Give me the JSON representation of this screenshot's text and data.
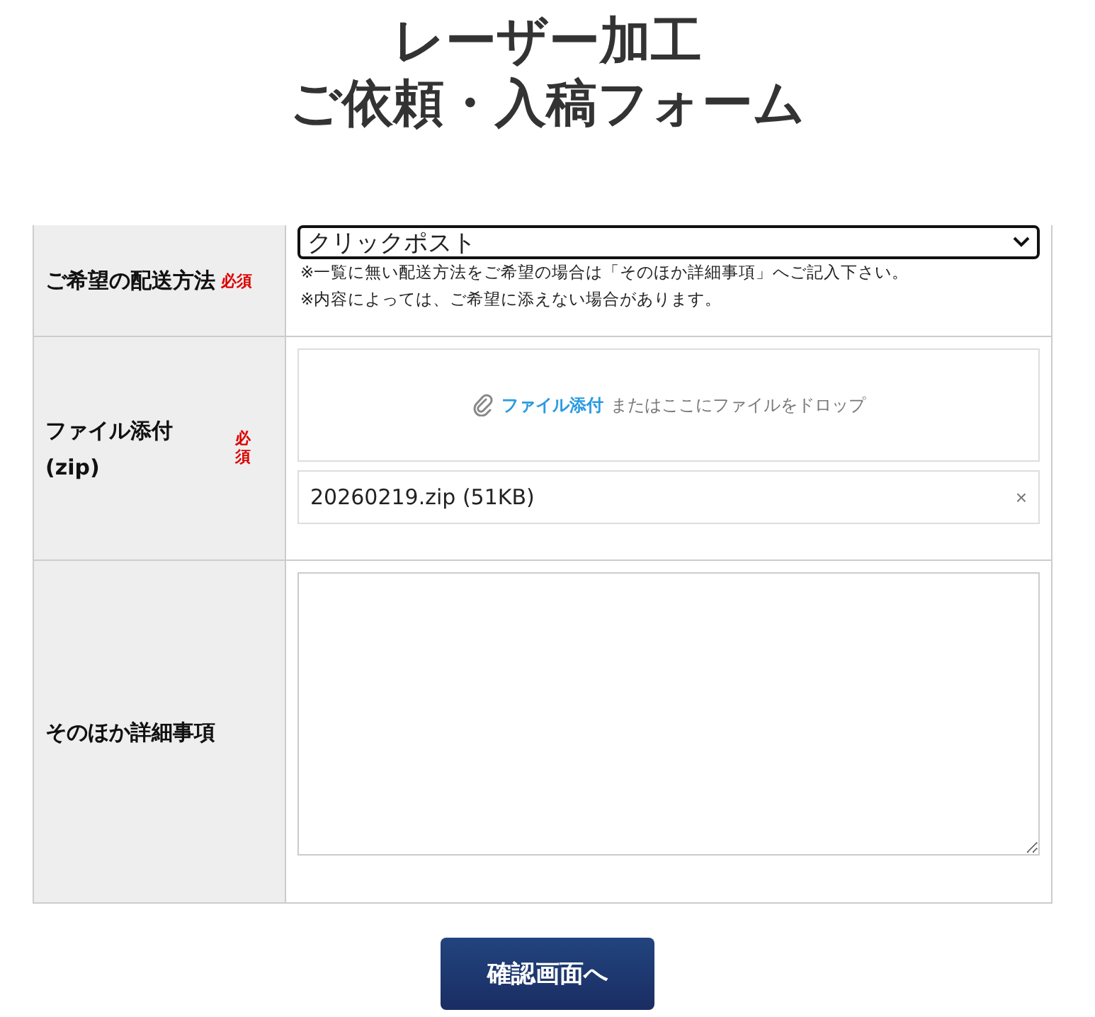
{
  "title_lines": [
    "レーザー加工",
    "ご依頼・入稿フォーム"
  ],
  "rows": [
    {
      "kind": "select",
      "label": "ご希望の配送方法",
      "required": "必須",
      "required_vertical": false,
      "value": "クリックポスト",
      "notes": [
        "※一覧に無い配送方法をご希望の場合は「そのほか詳細事項」へご記入下さい。",
        "※内容によっては、ご希望に添えない場合があります。"
      ]
    },
    {
      "kind": "file",
      "label": "ファイル添付\n(zip)",
      "required": "必須",
      "required_vertical": true,
      "drop_link": "ファイル添付",
      "drop_text": "またはここにファイルをドロップ",
      "file_name": "20260219.zip (51KB)",
      "remove": "×"
    },
    {
      "kind": "textarea",
      "label": "そのほか詳細事項"
    }
  ],
  "submit": "確認画面へ"
}
